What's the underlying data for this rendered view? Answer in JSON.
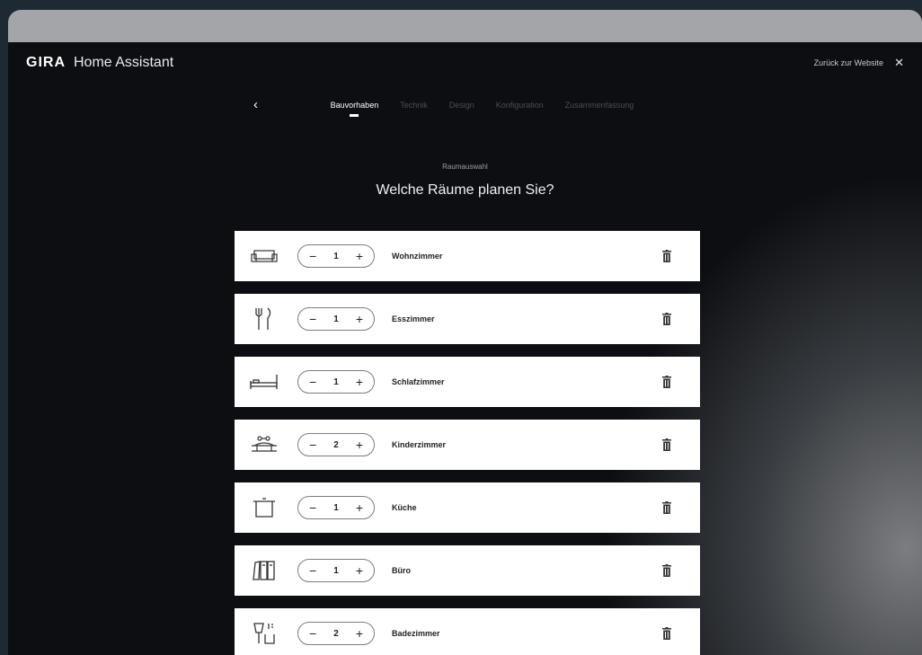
{
  "header": {
    "brand": "GIRA",
    "title": "Home Assistant",
    "back_link": "Zurück zur Website",
    "close_icon": "close-icon"
  },
  "steps": [
    {
      "label": "Bauvorhaben",
      "active": true
    },
    {
      "label": "Technik",
      "active": false
    },
    {
      "label": "Design",
      "active": false
    },
    {
      "label": "Konfiguration",
      "active": false
    },
    {
      "label": "Zusammenfassung",
      "active": false
    }
  ],
  "main": {
    "subtitle": "Raumauswahl",
    "headline": "Welche Räume planen Sie?"
  },
  "rooms": [
    {
      "name": "Wohnzimmer",
      "count": "1",
      "icon": "sofa-icon"
    },
    {
      "name": "Esszimmer",
      "count": "1",
      "icon": "cutlery-icon"
    },
    {
      "name": "Schlafzimmer",
      "count": "1",
      "icon": "bed-icon"
    },
    {
      "name": "Kinderzimmer",
      "count": "2",
      "icon": "toy-icon"
    },
    {
      "name": "Küche",
      "count": "1",
      "icon": "pot-icon"
    },
    {
      "name": "Büro",
      "count": "1",
      "icon": "folders-icon"
    },
    {
      "name": "Badezimmer",
      "count": "2",
      "icon": "bath-icon"
    }
  ],
  "stepper": {
    "minus": "−",
    "plus": "+"
  },
  "colors": {
    "background": "#0b0d11",
    "card": "#ffffff",
    "topbar": "#a3a5a8"
  }
}
